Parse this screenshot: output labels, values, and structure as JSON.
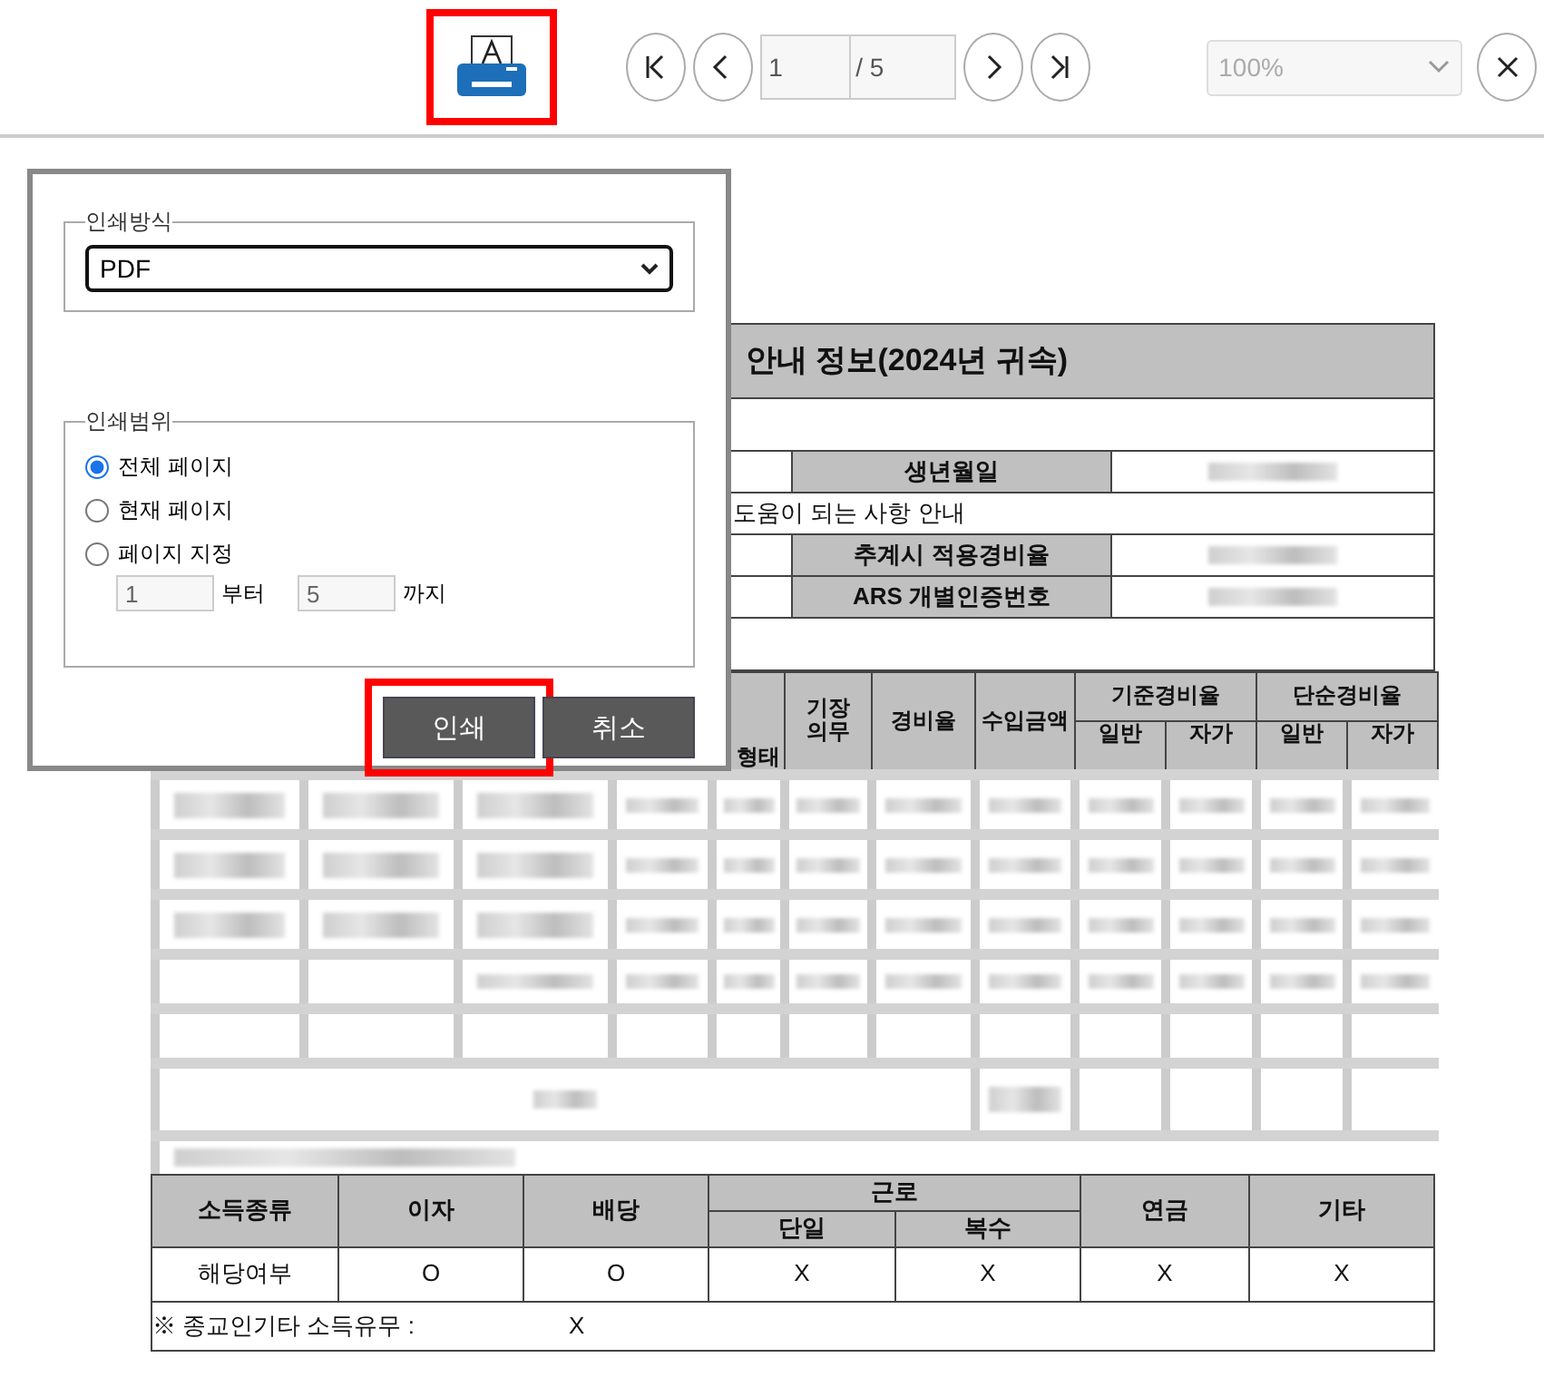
{
  "toolbar": {
    "print_button": {
      "highlighted": true
    },
    "page": {
      "current": "1",
      "total": "/ 5"
    },
    "zoom": "100%"
  },
  "dialog": {
    "method": {
      "legend": "인쇄방식",
      "value": "PDF"
    },
    "range": {
      "legend": "인쇄범위",
      "options": [
        {
          "label": "전체 페이지",
          "selected": true
        },
        {
          "label": "현재 페이지",
          "selected": false
        },
        {
          "label": "페이지 지정",
          "selected": false
        }
      ],
      "from": "1",
      "from_label": "부터",
      "to": "5",
      "to_label": "까지"
    },
    "buttons": [
      {
        "label": "인쇄",
        "highlighted": true
      },
      {
        "label": "취소",
        "highlighted": false
      }
    ]
  },
  "document": {
    "title": "안내 정보(2024년 귀속)",
    "info_rows": [
      {
        "kind": "field",
        "label": "생년월일"
      },
      {
        "kind": "note",
        "text": "도움이 되는 사항 안내"
      },
      {
        "kind": "field",
        "label": "추계시 적용경비율"
      },
      {
        "kind": "field",
        "label": "ARS 개별인증번호"
      }
    ],
    "columns": [
      "형태",
      "기장의무",
      "경비율",
      "수입금액"
    ],
    "groups": [
      {
        "label": "기준경비율",
        "subs": [
          "일반",
          "자가"
        ]
      },
      {
        "label": "단순경비율",
        "subs": [
          "일반",
          "자가"
        ]
      }
    ],
    "income": {
      "headers": [
        "소득종류",
        "이자",
        "배당"
      ],
      "group": {
        "label": "근로",
        "subs": [
          "단일",
          "복수"
        ]
      },
      "tail_headers": [
        "연금",
        "기타"
      ],
      "row": [
        "해당여부",
        "O",
        "O",
        "X",
        "X",
        "X",
        "X"
      ]
    },
    "note": {
      "label": "※ 종교인기타 소득유무 :",
      "value": "X"
    }
  }
}
